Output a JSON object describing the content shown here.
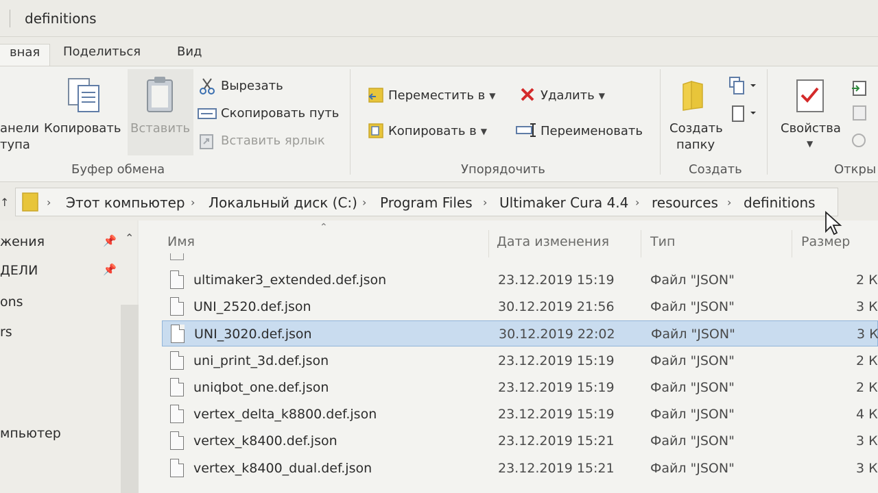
{
  "window": {
    "title": "definitions"
  },
  "tabs": [
    {
      "label": "вная",
      "active": true
    },
    {
      "label": "Поделиться"
    },
    {
      "label": "Вид"
    }
  ],
  "ribbon": {
    "clipboard": {
      "pin_label_line1": "анели",
      "pin_label_line2": "тупа",
      "copy": "Копировать",
      "paste": "Вставить",
      "cut": "Вырезать",
      "copy_path": "Скопировать путь",
      "paste_shortcut": "Вставить ярлык",
      "group_label": "Буфер обмена"
    },
    "organize": {
      "move_to": "Переместить в",
      "copy_to": "Копировать в",
      "delete": "Удалить",
      "rename": "Переименовать",
      "group_label": "Упорядочить"
    },
    "new": {
      "new_folder_line1": "Создать",
      "new_folder_line2": "папку",
      "group_label": "Создать"
    },
    "open": {
      "properties": "Свойства",
      "group_label": "Откры"
    }
  },
  "address": {
    "crumbs": [
      "Этот компьютер",
      "Локальный диск (C:)",
      "Program Files",
      "Ultimaker Cura 4.4",
      "resources",
      "definitions"
    ]
  },
  "nav": {
    "items": [
      "жения",
      "ДЕЛИ",
      "ons",
      "rs",
      "мпьютер"
    ]
  },
  "columns": {
    "name": "Имя",
    "date": "Дата изменения",
    "type": "Тип",
    "size": "Размер"
  },
  "files": [
    {
      "name": "ultimaker3_extended.def.json",
      "date": "23.12.2019 15:19",
      "type": "Файл \"JSON\"",
      "size": "2 К"
    },
    {
      "name": "UNI_2520.def.json",
      "date": "30.12.2019 21:56",
      "type": "Файл \"JSON\"",
      "size": "3 К"
    },
    {
      "name": "UNI_3020.def.json",
      "date": "30.12.2019 22:02",
      "type": "Файл \"JSON\"",
      "size": "3 К",
      "selected": true
    },
    {
      "name": "uni_print_3d.def.json",
      "date": "23.12.2019 15:19",
      "type": "Файл \"JSON\"",
      "size": "2 К"
    },
    {
      "name": "uniqbot_one.def.json",
      "date": "23.12.2019 15:19",
      "type": "Файл \"JSON\"",
      "size": "2 К"
    },
    {
      "name": "vertex_delta_k8800.def.json",
      "date": "23.12.2019 15:19",
      "type": "Файл \"JSON\"",
      "size": "4 К"
    },
    {
      "name": "vertex_k8400.def.json",
      "date": "23.12.2019 15:21",
      "type": "Файл \"JSON\"",
      "size": "3 К"
    },
    {
      "name": "vertex_k8400_dual.def.json",
      "date": "23.12.2019 15:21",
      "type": "Файл \"JSON\"",
      "size": "3 К"
    }
  ],
  "colors": {
    "selection": "#c9dcef",
    "selection_border": "#8fb3d9",
    "folder": "#e8c53a",
    "delete_red": "#d42a2a"
  }
}
